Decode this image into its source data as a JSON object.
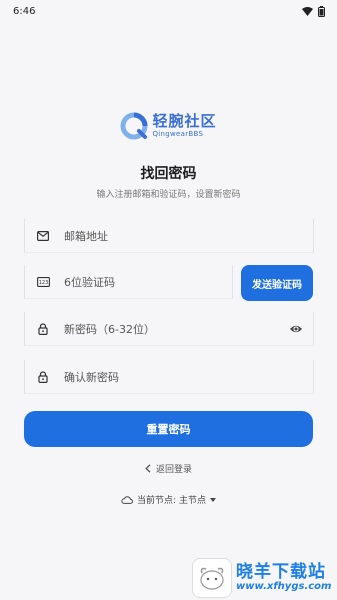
{
  "status_bar": {
    "time": "6:46"
  },
  "logo": {
    "name_cn": "轻腕社区",
    "name_en": "QingwearBBS"
  },
  "page": {
    "title": "找回密码",
    "subtitle": "输入注册邮箱和验证码，设置新密码"
  },
  "form": {
    "email_placeholder": "邮箱地址",
    "code_placeholder": "6位验证码",
    "send_code_label": "发送验证码",
    "new_password_placeholder": "新密码（6-32位）",
    "confirm_password_placeholder": "确认新密码",
    "reset_label": "重置密码"
  },
  "back_link": {
    "label": "返回登录"
  },
  "node": {
    "label": "当前节点: 主节点"
  },
  "watermark": {
    "name": "晓羊下载站",
    "url": "www.xfhygs.com"
  },
  "colors": {
    "primary": "#1f6fe0",
    "background": "#f6f6f8",
    "logo": "#3a6fd6"
  },
  "icons": [
    "mail-icon",
    "code-icon",
    "lock-icon",
    "eye-icon",
    "chevron-left-icon",
    "cloud-icon",
    "caret-down-icon",
    "wifi-icon",
    "battery-icon"
  ]
}
